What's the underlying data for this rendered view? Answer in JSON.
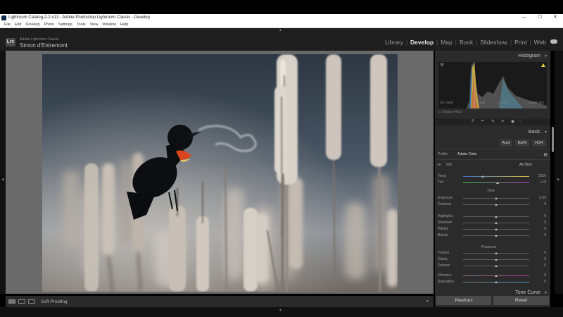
{
  "window": {
    "title": "Lightroom Catalog-2-2-v13 - Adobe Photoshop Lightroom Classic - Develop",
    "controls": [
      "—",
      "☐",
      "✕"
    ]
  },
  "menu": [
    "File",
    "Edit",
    "Develop",
    "Photo",
    "Settings",
    "Tools",
    "View",
    "Window",
    "Help"
  ],
  "brand": {
    "logo": "Lrc",
    "product": "Adobe Lightroom Classic",
    "user": "Simon d'Entremont"
  },
  "modules": [
    {
      "label": "Library",
      "active": false
    },
    {
      "label": "Develop",
      "active": true
    },
    {
      "label": "Map",
      "active": false
    },
    {
      "label": "Book",
      "active": false
    },
    {
      "label": "Slideshow",
      "active": false
    },
    {
      "label": "Print",
      "active": false
    },
    {
      "label": "Web",
      "active": false
    }
  ],
  "histogram": {
    "label": "Histogram",
    "iso": "ISO 1600",
    "focal": "700 mm",
    "aperture": "ƒ / 5.6",
    "shutter": "1/2000 sec",
    "original": "Original Photo"
  },
  "basic": {
    "label": "Basic",
    "buttons": [
      "Auto",
      "B&W",
      "HDR"
    ],
    "profile_label": "Profile",
    "profile_value": "Adobe Color",
    "wb_label": "WB",
    "wb_value": "As Shot",
    "tone_label": "Tone",
    "presence_label": "Presence",
    "sliders": [
      {
        "label": "Temp",
        "value": "5250",
        "pos": 0.3,
        "group": "wb"
      },
      {
        "label": "Tint",
        "value": "+10",
        "pos": 0.52,
        "group": "wb"
      },
      {
        "label": "Exposure",
        "value": "0.00",
        "pos": 0.5,
        "group": "tone"
      },
      {
        "label": "Contrast",
        "value": "0",
        "pos": 0.5,
        "group": "tone"
      },
      {
        "label": "Highlights",
        "value": "0",
        "pos": 0.5,
        "group": "tone2"
      },
      {
        "label": "Shadows",
        "value": "0",
        "pos": 0.5,
        "group": "tone2"
      },
      {
        "label": "Whites",
        "value": "0",
        "pos": 0.5,
        "group": "tone2"
      },
      {
        "label": "Blacks",
        "value": "0",
        "pos": 0.5,
        "group": "tone2"
      },
      {
        "label": "Texture",
        "value": "0",
        "pos": 0.5,
        "group": "presence"
      },
      {
        "label": "Clarity",
        "value": "0",
        "pos": 0.5,
        "group": "presence"
      },
      {
        "label": "Dehaze",
        "value": "0",
        "pos": 0.5,
        "group": "presence"
      },
      {
        "label": "Vibrance",
        "value": "0",
        "pos": 0.5,
        "group": "presence2"
      },
      {
        "label": "Saturation",
        "value": "0",
        "pos": 0.5,
        "group": "presence2"
      }
    ],
    "next_panel": "Tone Curve"
  },
  "toolbar": {
    "soft_proofing": "Soft Proofing"
  },
  "footer": {
    "previous": "Previous",
    "reset": "Reset"
  }
}
